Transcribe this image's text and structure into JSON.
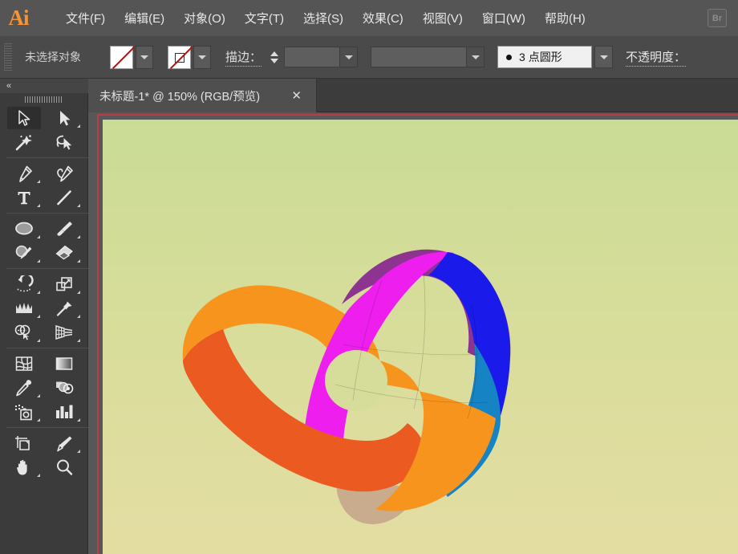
{
  "app": {
    "name": "Adobe Illustrator",
    "logo_text": "Ai",
    "bridge_label": "Br"
  },
  "menubar": {
    "items": [
      {
        "label": "文件(F)",
        "name": "menu-file"
      },
      {
        "label": "编辑(E)",
        "name": "menu-edit"
      },
      {
        "label": "对象(O)",
        "name": "menu-object"
      },
      {
        "label": "文字(T)",
        "name": "menu-type"
      },
      {
        "label": "选择(S)",
        "name": "menu-select"
      },
      {
        "label": "效果(C)",
        "name": "menu-effect"
      },
      {
        "label": "视图(V)",
        "name": "menu-view"
      },
      {
        "label": "窗口(W)",
        "name": "menu-window"
      },
      {
        "label": "帮助(H)",
        "name": "menu-help"
      }
    ]
  },
  "controlbar": {
    "selection_status": "未选择对象",
    "fill_swatch": "none",
    "stroke_swatch": "none",
    "stroke_label": "描边：",
    "stroke_weight_value": "",
    "stroke_profile_value": "",
    "brush_value": "3 点圆形",
    "opacity_label": "不透明度："
  },
  "tabbar": {
    "tabs": [
      {
        "title": "未标题-1* @ 150% (RGB/预览)",
        "close": "✕",
        "active": true
      }
    ]
  },
  "toolpanel": {
    "collapse_label": "«",
    "tools": [
      {
        "name": "selection-tool",
        "label": "选择工具",
        "active": true,
        "flyout": false
      },
      {
        "name": "direct-selection-tool",
        "label": "直接选择工具",
        "active": false,
        "flyout": true
      },
      {
        "name": "magic-wand-tool",
        "label": "魔棒工具",
        "active": false,
        "flyout": false
      },
      {
        "name": "lasso-tool",
        "label": "套索工具",
        "active": false,
        "flyout": false
      },
      {
        "name": "pen-tool",
        "label": "钢笔工具",
        "active": false,
        "flyout": true
      },
      {
        "name": "curvature-tool",
        "label": "曲率工具",
        "active": false,
        "flyout": false
      },
      {
        "name": "type-tool",
        "label": "文字工具",
        "active": false,
        "flyout": true
      },
      {
        "name": "line-segment-tool",
        "label": "直线段工具",
        "active": false,
        "flyout": true
      },
      {
        "name": "ellipse-tool",
        "label": "椭圆工具",
        "active": false,
        "flyout": true
      },
      {
        "name": "paintbrush-tool",
        "label": "画笔工具",
        "active": false,
        "flyout": true
      },
      {
        "name": "shaper-tool",
        "label": "Shaper 工具",
        "active": false,
        "flyout": true
      },
      {
        "name": "eraser-tool",
        "label": "橡皮擦工具",
        "active": false,
        "flyout": true
      },
      {
        "name": "rotate-tool",
        "label": "旋转工具",
        "active": false,
        "flyout": true
      },
      {
        "name": "scale-tool",
        "label": "缩放工具",
        "active": false,
        "flyout": true
      },
      {
        "name": "width-tool",
        "label": "宽度工具",
        "active": false,
        "flyout": true
      },
      {
        "name": "free-transform-tool",
        "label": "自由变换工具",
        "active": false,
        "flyout": true
      },
      {
        "name": "shape-builder-tool",
        "label": "形状生成器工具",
        "active": false,
        "flyout": true
      },
      {
        "name": "perspective-grid-tool",
        "label": "透视网格工具",
        "active": false,
        "flyout": true
      },
      {
        "name": "mesh-tool",
        "label": "网格工具",
        "active": false,
        "flyout": false
      },
      {
        "name": "gradient-tool",
        "label": "渐变工具",
        "active": false,
        "flyout": false
      },
      {
        "name": "eyedropper-tool",
        "label": "吸管工具",
        "active": false,
        "flyout": true
      },
      {
        "name": "blend-tool",
        "label": "混合工具",
        "active": false,
        "flyout": false
      },
      {
        "name": "symbol-sprayer-tool",
        "label": "符号喷枪工具",
        "active": false,
        "flyout": true
      },
      {
        "name": "column-graph-tool",
        "label": "柱形图工具",
        "active": false,
        "flyout": true
      },
      {
        "name": "artboard-tool",
        "label": "画板工具",
        "active": false,
        "flyout": false
      },
      {
        "name": "slice-tool",
        "label": "切片工具",
        "active": false,
        "flyout": true
      },
      {
        "name": "hand-tool",
        "label": "抓手工具",
        "active": false,
        "flyout": true
      },
      {
        "name": "zoom-tool",
        "label": "缩放工具",
        "active": false,
        "flyout": false
      }
    ]
  },
  "canvas": {
    "zoom": "150%",
    "color_mode": "RGB",
    "view_mode": "预览",
    "artboard_border_color": "#c0394b",
    "background_gradient_top": "#c9dc95",
    "background_gradient_bottom": "#e4dda3",
    "artwork": {
      "name": "3d-revolved-pinwheel",
      "colors": {
        "magenta": "#ee1fee",
        "purple": "#8d3390",
        "blue": "#1a1aeb",
        "cyan": "#1683c4",
        "orange_light": "#f7941e",
        "orange_dark": "#ea5a21",
        "tan": "#c9ab8e"
      }
    }
  }
}
